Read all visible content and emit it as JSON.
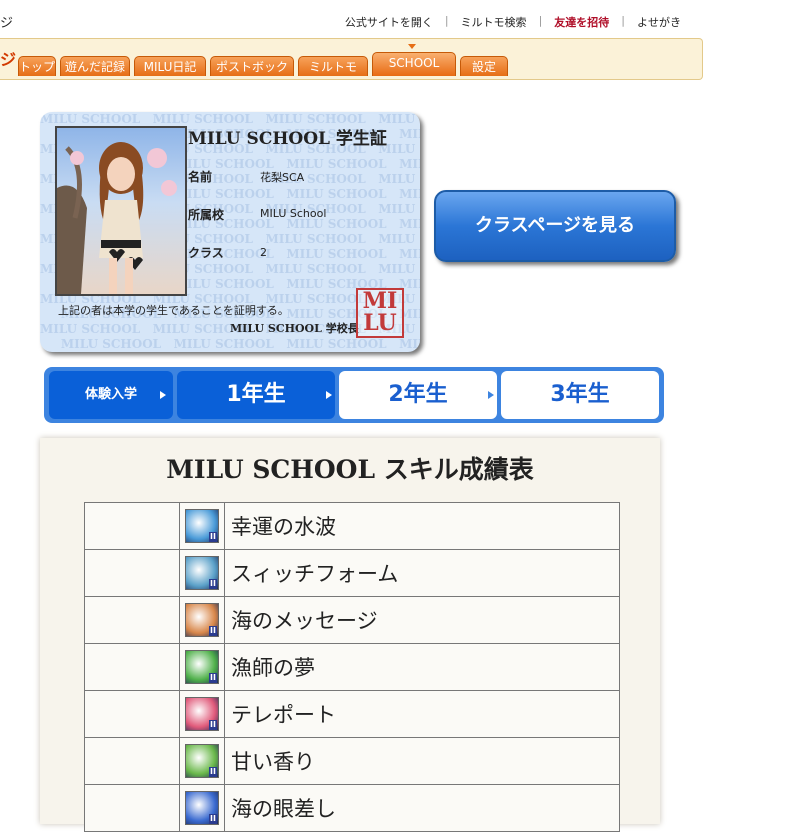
{
  "header": {
    "page_tag": "ジ",
    "links": [
      {
        "label": "公式サイトを開く"
      },
      {
        "label": "ミルトモ検索"
      },
      {
        "label": "友達を招待"
      },
      {
        "label": "よせがき"
      }
    ]
  },
  "nav": {
    "logo": "ジ",
    "tabs": [
      {
        "label": "トップ"
      },
      {
        "label": "遊んだ記録"
      },
      {
        "label": "MILU日記"
      },
      {
        "label": "ポストボックス"
      },
      {
        "label": "ミルトモ"
      },
      {
        "label": "SCHOOL"
      },
      {
        "label": "設定"
      }
    ],
    "active_tab": "SCHOOL",
    "accent": "#e66e16"
  },
  "student_card": {
    "title": "MILU SCHOOL 学生証",
    "fields": [
      {
        "label": "名前",
        "value": "花梨SCA"
      },
      {
        "label": "所属校",
        "value": "MILU School"
      },
      {
        "label": "クラス",
        "value": "2"
      }
    ],
    "certification": "上記の者は本学の学生であることを証明する。",
    "principal": "MILU SCHOOL 学校長",
    "seal_top": "MI",
    "seal_bottom": "LU",
    "watermark": "MILU SCHOOL"
  },
  "class_button": {
    "label": "クラスページを見る"
  },
  "grades": [
    {
      "label": "体験入学"
    },
    {
      "label": "1年生"
    },
    {
      "label": "2年生"
    },
    {
      "label": "3年生"
    }
  ],
  "active_grade": "1年生",
  "skills": {
    "title": "MILU SCHOOL スキル成績表",
    "level_badge": "II",
    "rows": [
      {
        "name": "幸運の水波",
        "icon": "water-wave-icon",
        "color": "#4a9bd8"
      },
      {
        "name": "スィッチフォーム",
        "icon": "switch-form-icon",
        "color": "#5aa0c8"
      },
      {
        "name": "海のメッセージ",
        "icon": "sea-message-icon",
        "color": "#d8874a"
      },
      {
        "name": "漁師の夢",
        "icon": "fisher-dream-icon",
        "color": "#4fb04a"
      },
      {
        "name": "テレポート",
        "icon": "teleport-icon",
        "color": "#e05a7a"
      },
      {
        "name": "甘い香り",
        "icon": "sweet-scent-icon",
        "color": "#6ab84a"
      },
      {
        "name": "海の眼差し",
        "icon": "sea-gaze-icon",
        "color": "#3a6ad0"
      }
    ]
  }
}
